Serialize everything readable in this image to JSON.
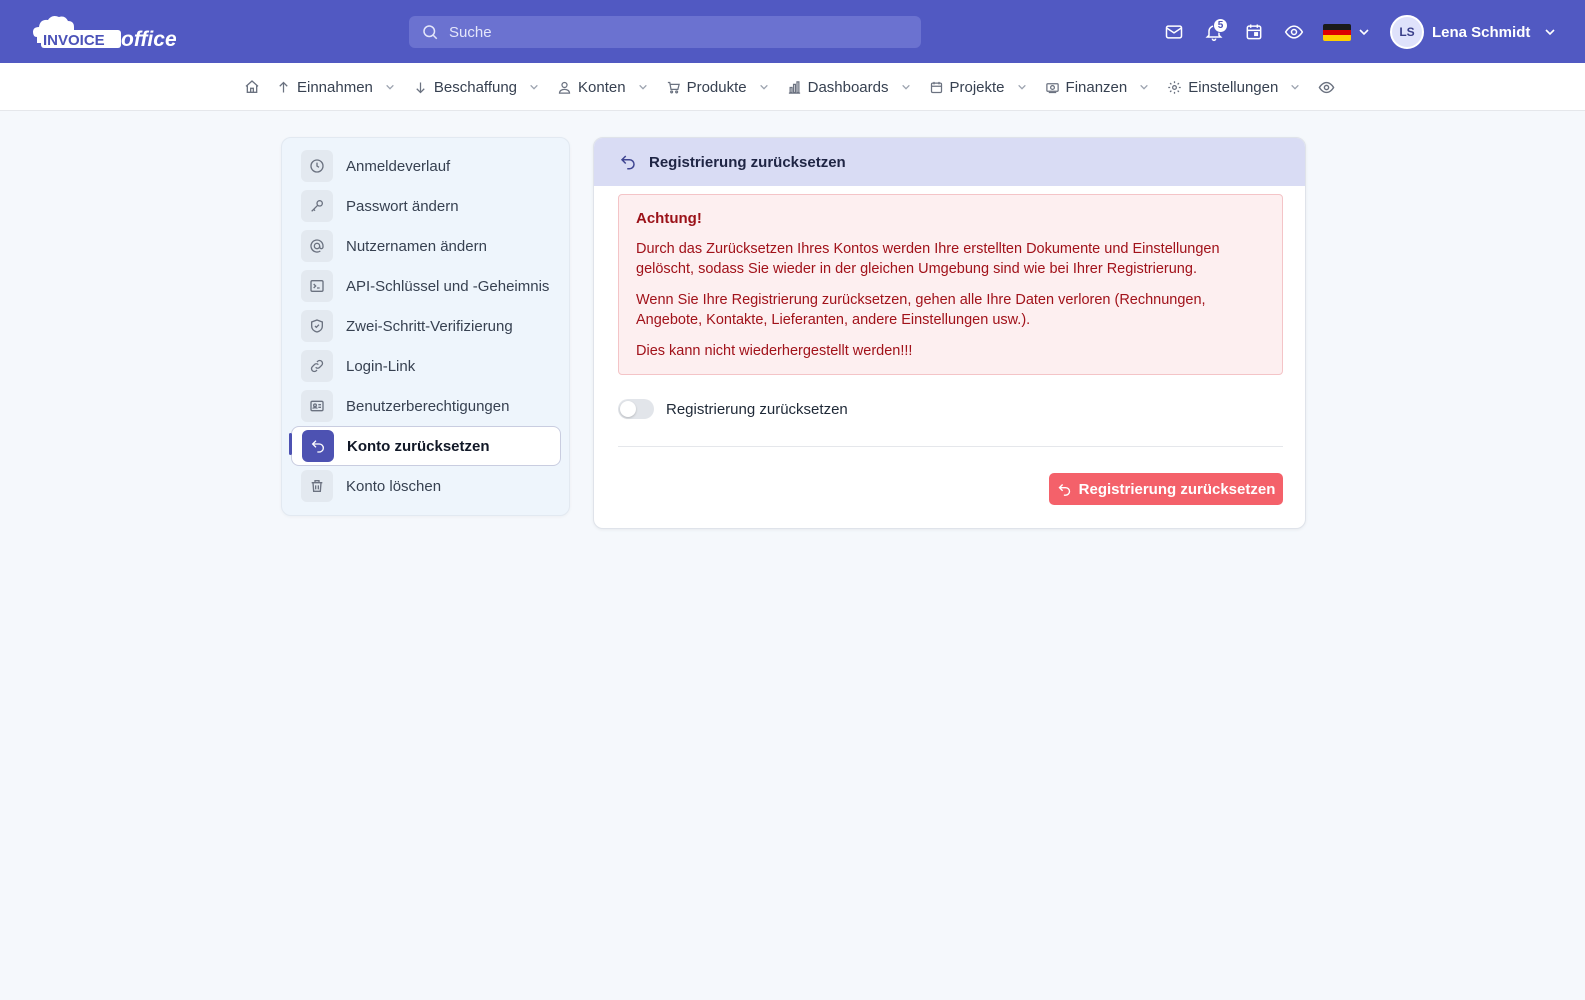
{
  "app": {
    "logo_text_left": "INVOICE",
    "logo_text_right": "office"
  },
  "topbar": {
    "search_placeholder": "Suche",
    "notification_count": "5",
    "user_initials": "LS",
    "user_name": "Lena Schmidt"
  },
  "nav": {
    "items": [
      {
        "label": "Einnahmen",
        "icon": "arrow-up-icon"
      },
      {
        "label": "Beschaffung",
        "icon": "arrow-down-icon"
      },
      {
        "label": "Konten",
        "icon": "user-icon"
      },
      {
        "label": "Produkte",
        "icon": "cart-icon"
      },
      {
        "label": "Dashboards",
        "icon": "bar-chart-icon"
      },
      {
        "label": "Projekte",
        "icon": "calendar-icon"
      },
      {
        "label": "Finanzen",
        "icon": "money-icon"
      },
      {
        "label": "Einstellungen",
        "icon": "gear-icon"
      }
    ]
  },
  "sidebar": {
    "items": [
      {
        "label": "Anmeldeverlauf",
        "icon": "clock-icon"
      },
      {
        "label": "Passwort ändern",
        "icon": "key-icon"
      },
      {
        "label": "Nutzernamen ändern",
        "icon": "at-icon"
      },
      {
        "label": "API-Schlüssel und -Geheimnis",
        "icon": "terminal-icon"
      },
      {
        "label": "Zwei-Schritt-Verifizierung",
        "icon": "shield-icon"
      },
      {
        "label": "Login-Link",
        "icon": "link-icon"
      },
      {
        "label": "Benutzerberechtigungen",
        "icon": "id-card-icon"
      },
      {
        "label": "Konto zurücksetzen",
        "icon": "undo-icon",
        "active": true
      },
      {
        "label": "Konto löschen",
        "icon": "trash-icon"
      }
    ]
  },
  "main": {
    "title": "Registrierung zurücksetzen",
    "alert": {
      "heading": "Achtung!",
      "p1": "Durch das Zurücksetzen Ihres Kontos werden Ihre erstellten Dokumente und Einstellungen gelöscht, sodass Sie wieder in der gleichen Umgebung sind wie bei Ihrer Registrierung.",
      "p2": "Wenn Sie Ihre Registrierung zurücksetzen, gehen alle Ihre Daten verloren (Rechnungen, Angebote, Kontakte, Lieferanten, andere Einstellungen usw.).",
      "p3": "Dies kann nicht wiederhergestellt werden!!!"
    },
    "toggle_label": "Registrierung zurücksetzen",
    "toggle_on": false,
    "button_label": "Registrierung zurücksetzen"
  },
  "colors": {
    "brand": "#5159c2",
    "danger_button": "#f4616a",
    "alert_text": "#a1121a",
    "active_sidebar": "#4d52b2"
  }
}
